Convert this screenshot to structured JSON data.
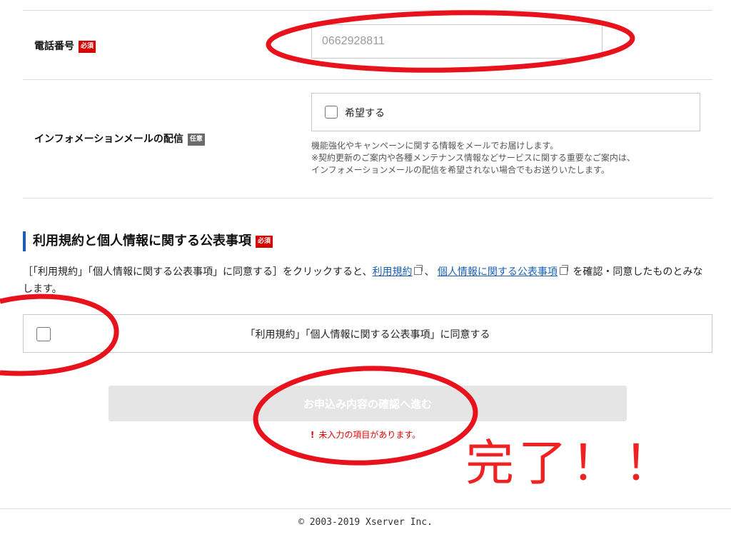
{
  "phone": {
    "label": "電話番号",
    "badge": "必須",
    "value": "0662928811"
  },
  "info_mail": {
    "label": "インフォメーションメールの配信",
    "badge": "任意",
    "checkbox_label": "希望する",
    "notes": [
      "機能強化やキャンペーンに関する情報をメールでお届けします。",
      "※契約更新のご案内や各種メンテナンス情報などサービスに関する重要なご案内は、",
      "インフォメーションメールの配信を希望されない場合でもお送りいたします。"
    ]
  },
  "terms": {
    "title": "利用規約と個人情報に関する公表事項",
    "badge": "必須",
    "desc_prefix": "［「利用規約」「個人情報に関する公表事項」に同意する］をクリックすると、",
    "link1": "利用規約",
    "separator": "、",
    "link2": "個人情報に関する公表事項",
    "desc_suffix": "を確認・同意したものとみなします。",
    "agree_label": "「利用規約」「個人情報に関する公表事項」に同意する"
  },
  "submit": {
    "label": "お申込み内容の確認へ進む",
    "error_icon": "!",
    "error": "未入力の項目があります。"
  },
  "annotation": {
    "text": "完了！！",
    "color": "#ee2222"
  },
  "footer": {
    "copyright": "© 2003-2019 Xserver Inc."
  },
  "colors": {
    "required_badge": "#d40000",
    "optional_badge": "#6b6b6b",
    "accent": "#1a5fb4",
    "error": "#e00000",
    "circle_marks": "#e8121c"
  }
}
